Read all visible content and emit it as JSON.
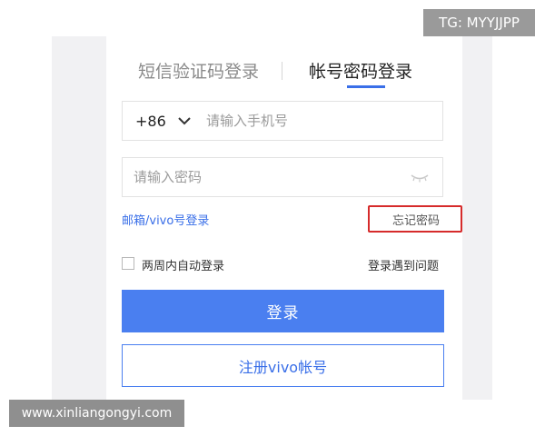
{
  "tabs": {
    "sms_login": "短信验证码登录",
    "password_login": "帐号密码登录"
  },
  "phone": {
    "country_code": "+86",
    "placeholder": "请输入手机号"
  },
  "password": {
    "placeholder": "请输入密码"
  },
  "links": {
    "email_vivo_login": "邮箱/vivo号登录",
    "forgot_password": "忘记密码",
    "login_problem": "登录遇到问题"
  },
  "remember": {
    "label": "两周内自动登录"
  },
  "buttons": {
    "login": "登录",
    "register": "注册vivo帐号"
  },
  "watermarks": {
    "top_right": "TG: MYYJJPP",
    "bottom_left": "www.xinliangongyi.com"
  },
  "colors": {
    "accent": "#4a7ff0",
    "highlight_box": "#d62b2b",
    "background_panel": "#f1f1f3"
  }
}
